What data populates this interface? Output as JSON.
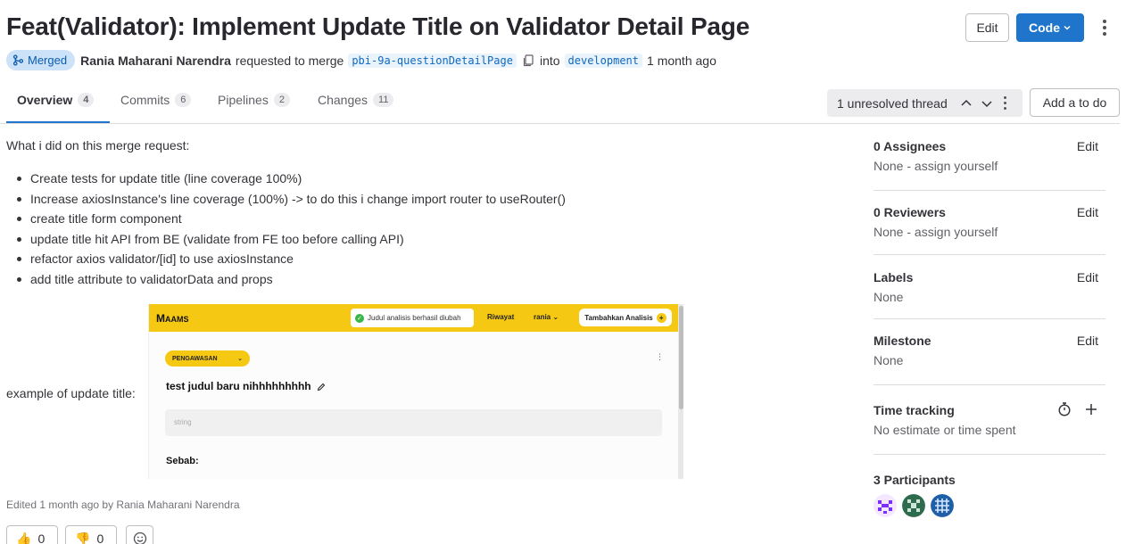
{
  "header": {
    "title": "Feat(Validator): Implement Update Title on Validator Detail Page",
    "edit_label": "Edit",
    "code_label": "Code"
  },
  "meta": {
    "status": "Merged",
    "author": "Rania Maharani Narendra",
    "requested_text": "requested to merge",
    "source_branch": "pbi-9a-questionDetailPage",
    "into_text": "into",
    "target_branch": "development",
    "time": "1 month ago"
  },
  "tabs": [
    {
      "label": "Overview",
      "count": "4"
    },
    {
      "label": "Commits",
      "count": "6"
    },
    {
      "label": "Pipelines",
      "count": "2"
    },
    {
      "label": "Changes",
      "count": "11"
    }
  ],
  "threads": {
    "label": "1 unresolved thread"
  },
  "todo_label": "Add a to do",
  "description": {
    "intro": "What i did on this merge request:",
    "items": [
      "Create tests for update title (line coverage 100%)",
      "Increase axiosInstance's line coverage (100%) -> to do this i change import router to useRouter()",
      "create title form component",
      "update title hit API from BE (validate from FE too before calling API)",
      "refactor axios validator/[id] to use axiosInstance",
      "add title attribute to validatorData and props"
    ],
    "example_label": "example of update title:"
  },
  "embedded_app": {
    "logo_m": "M",
    "logo_rest": "AAMS",
    "toast": "Judul analisis berhasil diubah",
    "nav_history": "Riwayat",
    "nav_user": "rania",
    "add_button": "Tambahkan Analisis",
    "category": "PENGAWASAN",
    "title": "test judul baru nihhhhhhhhh",
    "input_placeholder": "string",
    "cause_label": "Sebab:"
  },
  "edited": "Edited 1 month ago by Rania Maharani Narendra",
  "reactions": {
    "thumbs_up": "0",
    "thumbs_down": "0"
  },
  "sidebar": {
    "assignees": {
      "title": "0 Assignees",
      "value": "None - assign yourself",
      "edit": "Edit"
    },
    "reviewers": {
      "title": "0 Reviewers",
      "value": "None - assign yourself",
      "edit": "Edit"
    },
    "labels": {
      "title": "Labels",
      "value": "None",
      "edit": "Edit"
    },
    "milestone": {
      "title": "Milestone",
      "value": "None",
      "edit": "Edit"
    },
    "time_tracking": {
      "title": "Time tracking",
      "value": "No estimate or time spent"
    },
    "participants": {
      "title": "3 Participants"
    }
  },
  "colors": {
    "accent": "#1f75cb",
    "merged_badge": "#cbe2f9",
    "app_yellow": "#f5c814"
  }
}
